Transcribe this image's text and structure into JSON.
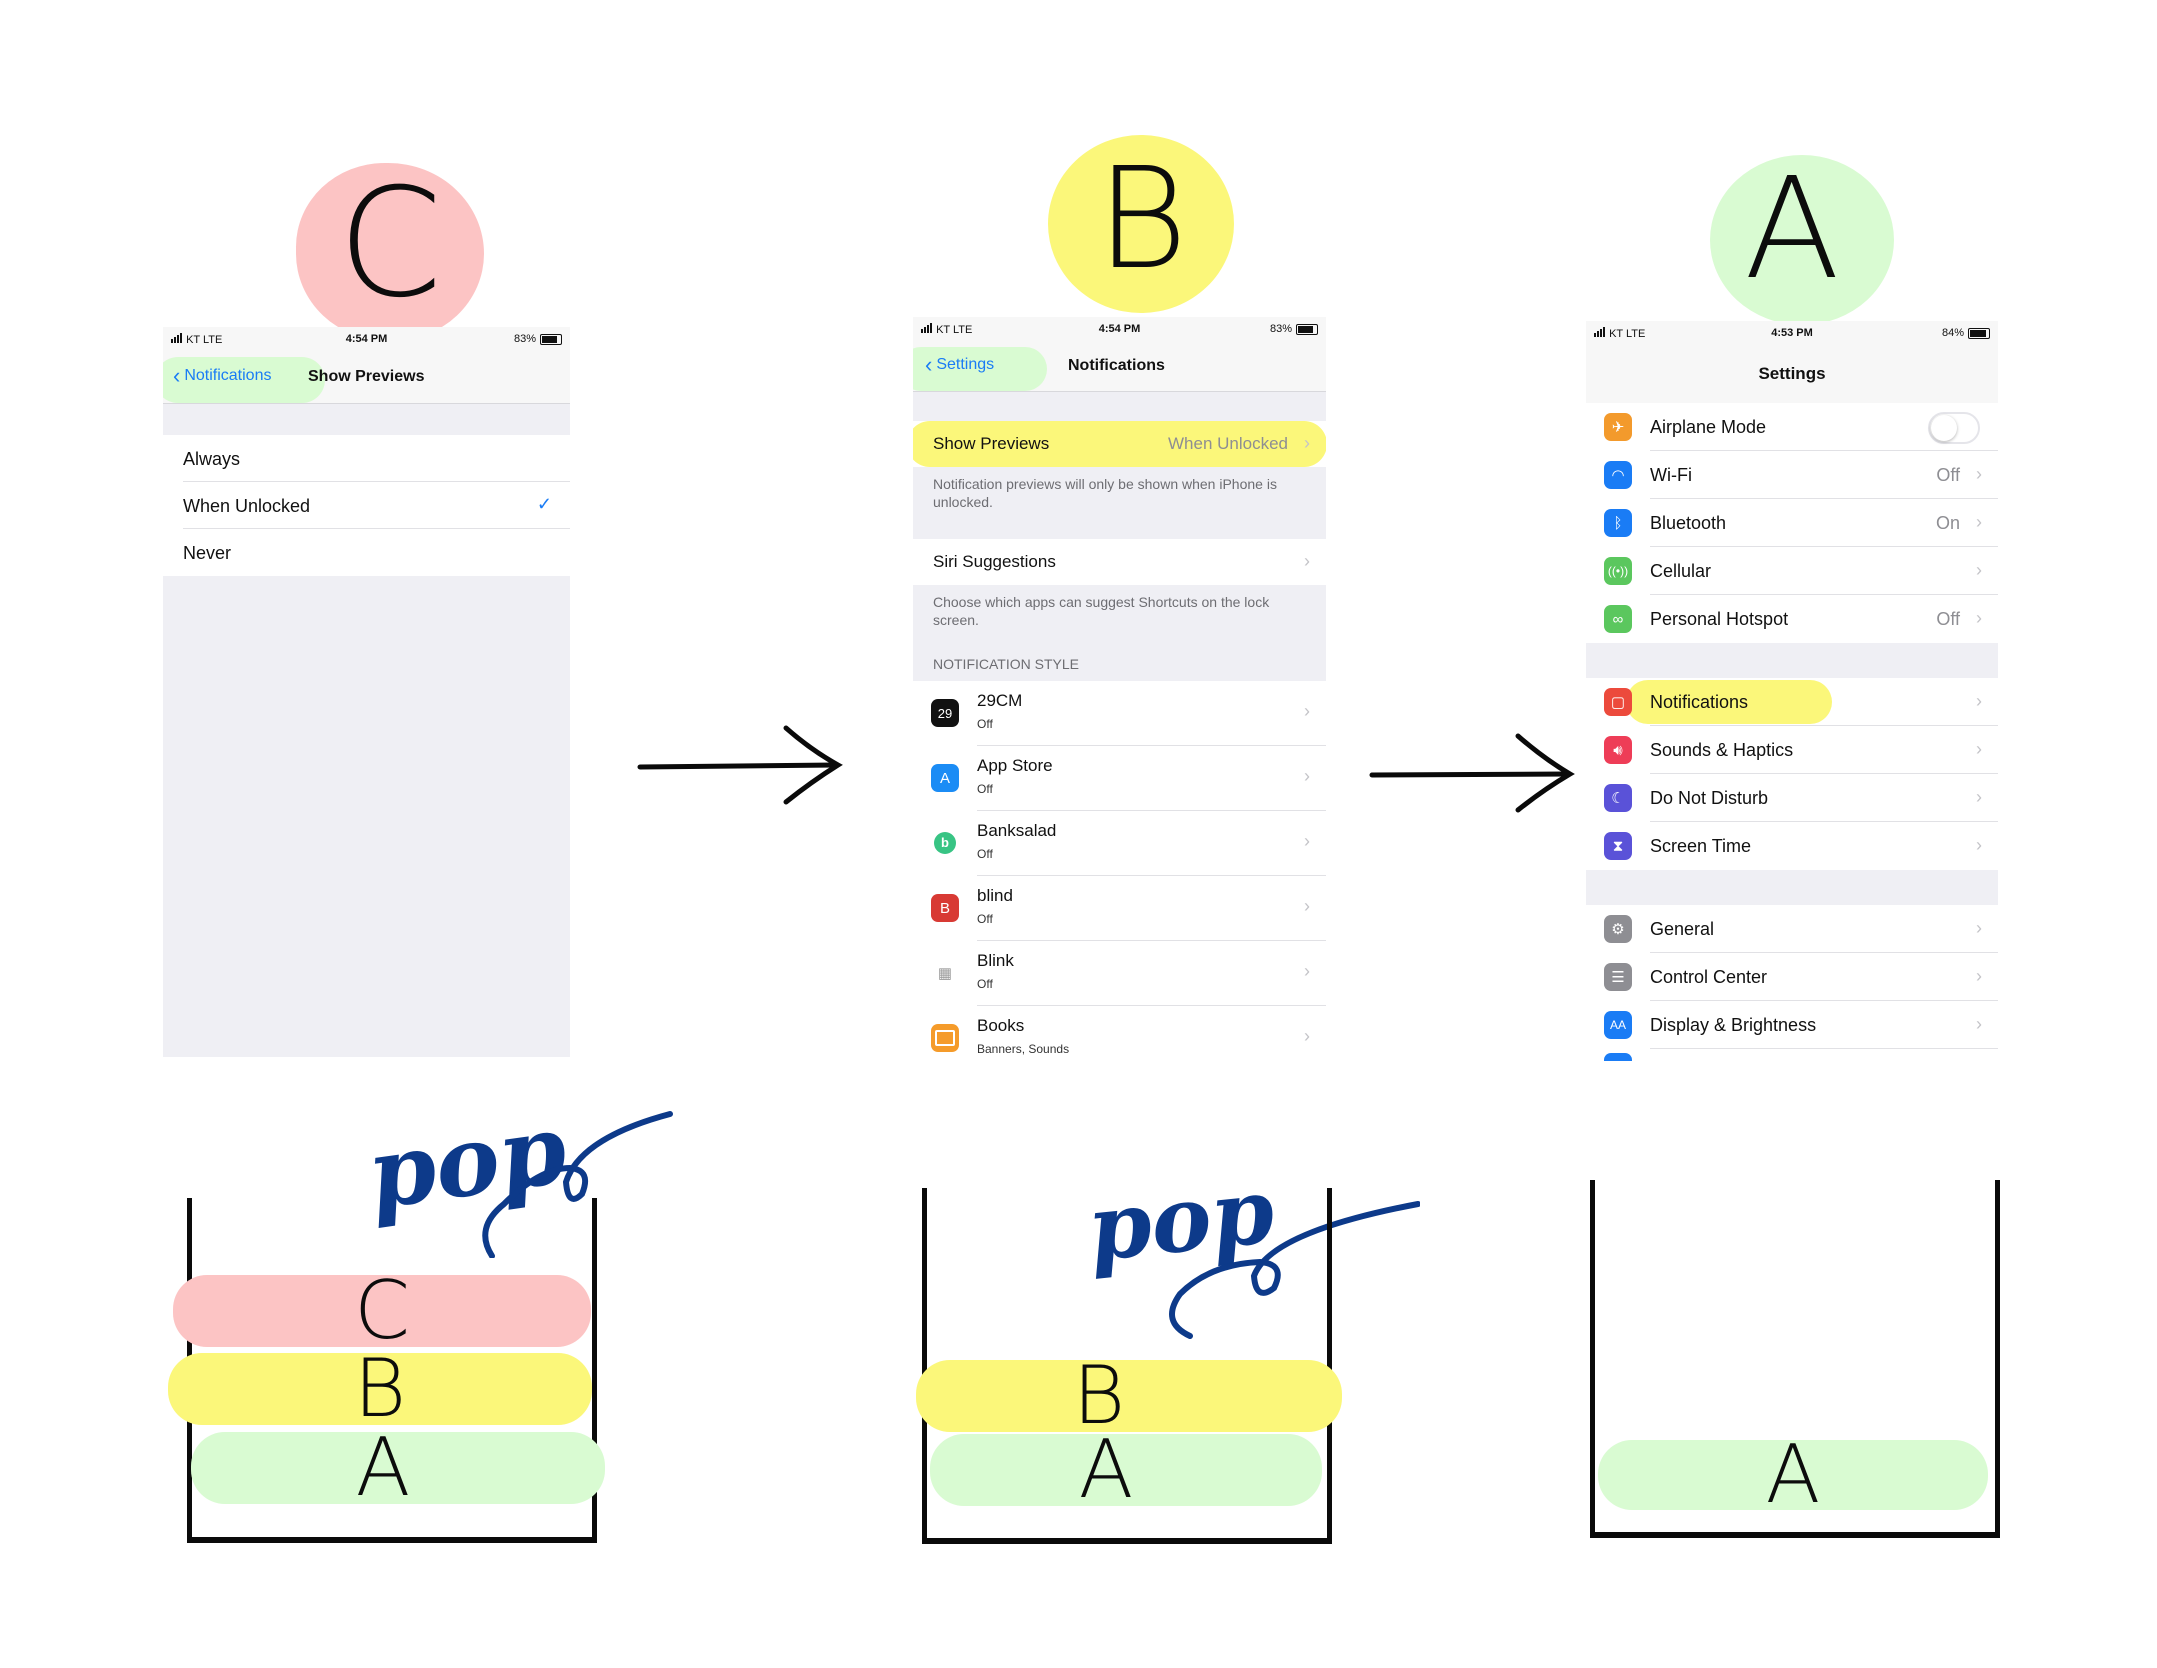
{
  "labels": {
    "c": "C",
    "b": "B",
    "a": "A"
  },
  "colors": {
    "pink": "#fcc4c4",
    "yellow": "#fbf77a",
    "green": "#d9fbd2",
    "ios_blue": "#1a7cf5",
    "pop_ink": "#0d3a8a"
  },
  "screen_c": {
    "status": {
      "carrier": "KT  LTE",
      "time": "4:54 PM",
      "battery": "83%"
    },
    "back_label": "Notifications",
    "title": "Show Previews",
    "options": [
      "Always",
      "When Unlocked",
      "Never"
    ],
    "selected": "When Unlocked"
  },
  "screen_b": {
    "status": {
      "carrier": "KT  LTE",
      "time": "4:54 PM",
      "battery": "83%"
    },
    "back_label": "Settings",
    "title": "Notifications",
    "show_previews": {
      "label": "Show Previews",
      "value": "When Unlocked"
    },
    "show_previews_note": "Notification previews will only be shown when iPhone is unlocked.",
    "siri": {
      "label": "Siri Suggestions"
    },
    "siri_note": "Choose which apps can suggest Shortcuts on the lock screen.",
    "section_header": "NOTIFICATION STYLE",
    "apps": [
      {
        "name": "29CM",
        "status": "Off",
        "icon": "29cm-icon",
        "glyph": "29"
      },
      {
        "name": "App Store",
        "status": "Off",
        "icon": "app-store-icon",
        "glyph": "A"
      },
      {
        "name": "Banksalad",
        "status": "Off",
        "icon": "banksalad-icon",
        "glyph": "b"
      },
      {
        "name": "blind",
        "status": "Off",
        "icon": "blind-icon",
        "glyph": "B"
      },
      {
        "name": "Blink",
        "status": "Off",
        "icon": "blink-icon",
        "glyph": "▦"
      },
      {
        "name": "Books",
        "status": "Banners, Sounds",
        "icon": "books-icon",
        "glyph": "📖"
      }
    ]
  },
  "screen_a": {
    "status": {
      "carrier": "KT  LTE",
      "time": "4:53 PM",
      "battery": "84%"
    },
    "title": "Settings",
    "group1": [
      {
        "label": "Airplane Mode",
        "icon": "airplane-icon",
        "toggle": true
      },
      {
        "label": "Wi-Fi",
        "icon": "wifi-icon",
        "value": "Off"
      },
      {
        "label": "Bluetooth",
        "icon": "bluetooth-icon",
        "value": "On"
      },
      {
        "label": "Cellular",
        "icon": "cellular-icon",
        "value": ""
      },
      {
        "label": "Personal Hotspot",
        "icon": "hotspot-icon",
        "value": "Off"
      }
    ],
    "group2": [
      {
        "label": "Notifications",
        "icon": "notifications-icon"
      },
      {
        "label": "Sounds & Haptics",
        "icon": "sounds-icon"
      },
      {
        "label": "Do Not Disturb",
        "icon": "moon-icon"
      },
      {
        "label": "Screen Time",
        "icon": "hourglass-icon"
      }
    ],
    "group3": [
      {
        "label": "General",
        "icon": "gear-icon"
      },
      {
        "label": "Control Center",
        "icon": "control-center-icon"
      },
      {
        "label": "Display & Brightness",
        "icon": "display-icon"
      }
    ]
  },
  "stacks": {
    "pop_label": "pop",
    "stack1": [
      "C",
      "B",
      "A"
    ],
    "stack2": [
      "B",
      "A"
    ],
    "stack3": [
      "A"
    ]
  }
}
